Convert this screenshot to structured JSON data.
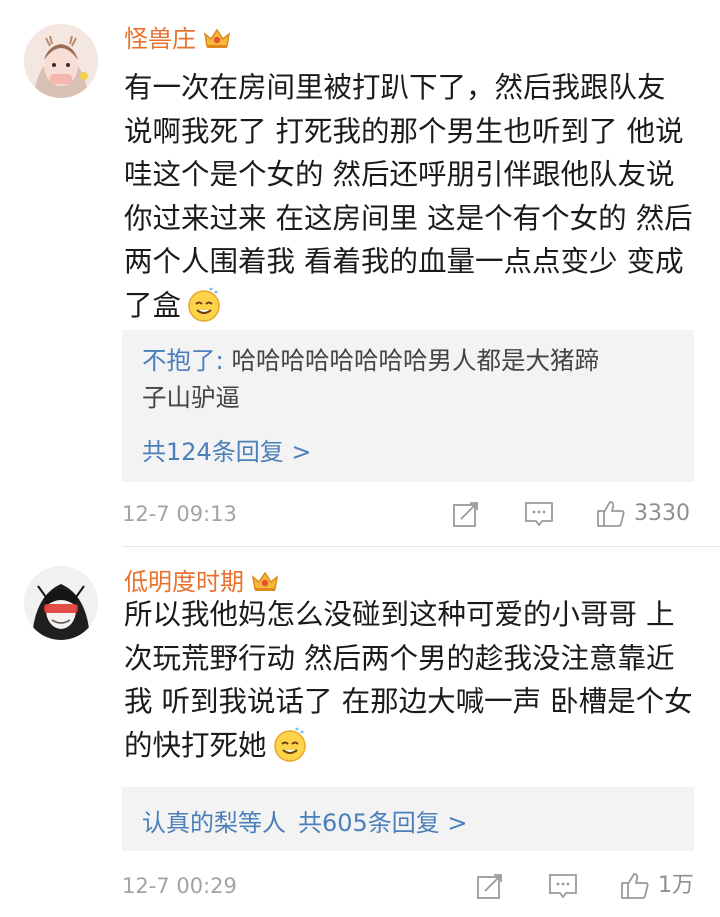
{
  "comments": [
    {
      "username": "怪兽庄",
      "lines": [
        "有一次在房间里被打趴下了，然后我跟队友",
        "说啊我死了 打死我的那个男生也听到了 他说",
        "哇这个是个女的 然后还呼朋引伴跟他队友说",
        "你过来过来 在这房间里 这是个有个女的 然后",
        "两个人围着我 看着我的血量一点点变少 变成",
        "了盒"
      ],
      "reply_preview": {
        "user": "不抱了:",
        "text": " 哈哈哈哈哈哈哈哈男人都是大猪蹄",
        "text_line2": "子山驴逼"
      },
      "reply_more": "共124条回复 >",
      "timestamp": "12-7 09:13",
      "likes": "3330"
    },
    {
      "username": "低明度时期",
      "lines": [
        "所以我他妈怎么没碰到这种可爱的小哥哥 上",
        "次玩荒野行动  然后两个男的趁我没注意靠近",
        "我 听到我说话了 在那边大喊一声 卧槽是个女",
        "的快打死她"
      ],
      "reply_preview_users": "认真的梨等人",
      "reply_more": "共605条回复 >",
      "timestamp": "12-7 00:29",
      "likes": "1万"
    }
  ],
  "icons": {
    "crown": "vip-crown-icon",
    "emoji": "sweat-smile-emoji-icon",
    "share": "share-icon",
    "comment": "comment-icon",
    "like": "thumbs-up-icon"
  },
  "colors": {
    "username": "#e8722c",
    "reply_link": "#4b7fbb",
    "meta_gray": "#a3a3a3",
    "reply_bg": "#f3f3f3"
  }
}
